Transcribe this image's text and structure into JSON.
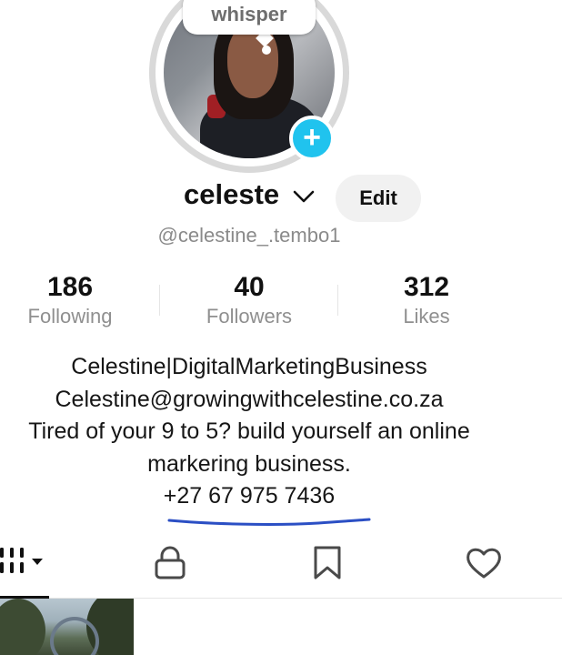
{
  "profile": {
    "avatar_bubble": "whisper",
    "add_icon": "plus-icon",
    "username": "celeste",
    "handle": "@celestine_.tembo1",
    "edit_label": "Edit"
  },
  "stats": [
    {
      "value": "186",
      "label": "Following"
    },
    {
      "value": "40",
      "label": "Followers"
    },
    {
      "value": "312",
      "label": "Likes"
    }
  ],
  "bio": {
    "line1": "Celestine|DigitalMarketingBusiness",
    "line2": "Celestine@growingwithcelestine.co.za",
    "line3": "Tired of your 9 to 5? build yourself an online",
    "line4": "markering business.",
    "line5": "+27 67 975 7436"
  },
  "tabs": {
    "icons": [
      "grid-icon",
      "lock-icon",
      "bookmark-icon",
      "heart-icon"
    ],
    "active": "grid-icon"
  },
  "colors": {
    "accent": "#20c3ee",
    "underline": "#2b4fc4",
    "muted": "#8f8f8f"
  }
}
